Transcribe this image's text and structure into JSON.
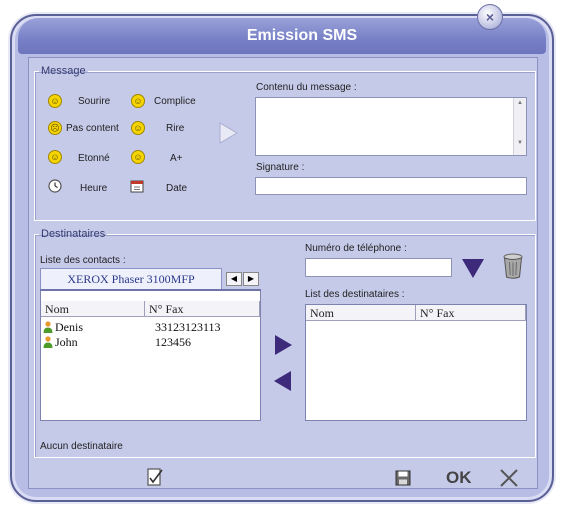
{
  "window": {
    "title": "Emission SMS"
  },
  "message": {
    "legend": "Message",
    "emoticons": [
      {
        "label": "Sourire",
        "glyph": "☺"
      },
      {
        "label": "Complice",
        "glyph": "☺"
      },
      {
        "label": "Pas content",
        "glyph": "☹"
      },
      {
        "label": "Rire",
        "glyph": "☺"
      },
      {
        "label": "Etonné",
        "glyph": "☺"
      },
      {
        "label": "A+",
        "glyph": "☺"
      },
      {
        "label": "Heure",
        "glyph": "clock-icon"
      },
      {
        "label": "Date",
        "glyph": "calendar-icon"
      }
    ],
    "content_label": "Contenu du message :",
    "content_value": "",
    "signature_label": "Signature :",
    "signature_value": ""
  },
  "recipients": {
    "legend": "Destinataires",
    "contacts_label": "Liste des contacts :",
    "contacts_tab": "XEROX Phaser 3100MFP",
    "contacts_columns": [
      "Nom",
      "N° Fax"
    ],
    "contacts": [
      {
        "name": "Denis",
        "fax": "33123123113"
      },
      {
        "name": "John",
        "fax": "123456"
      }
    ],
    "phone_label": "Numéro de téléphone :",
    "phone_value": "",
    "dest_label": "List des destinataires :",
    "dest_columns": [
      "Nom",
      "N° Fax"
    ],
    "status": "Aucun destinataire"
  },
  "footer": {
    "ok_label": "OK"
  },
  "colors": {
    "accent": "#3d2a7a",
    "panel": "#c5cae9",
    "title": "#7780c6"
  }
}
